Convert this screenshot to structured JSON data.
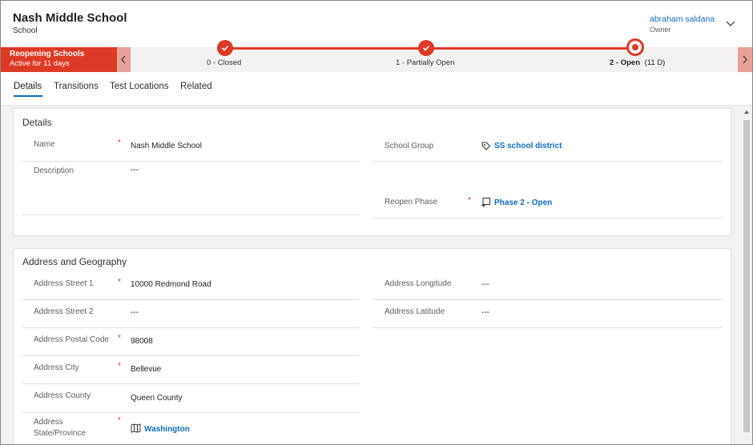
{
  "record": {
    "title": "Nash Middle School",
    "entity": "School"
  },
  "owner": {
    "name": "abraham saldana",
    "label": "Owner",
    "chevron_icon": "chevron-down-icon"
  },
  "bpf": {
    "process_name": "Reopening Schools",
    "active_for": "Active for 11 days",
    "stages": [
      {
        "label": "0 - Closed",
        "status": "completed"
      },
      {
        "label": "1 - Partially Open",
        "status": "completed"
      },
      {
        "label": "2 - Open",
        "duration": "(11 D)",
        "status": "active"
      }
    ],
    "accent_color": "#dd3a26"
  },
  "tabs": [
    {
      "label": "Details",
      "selected": true
    },
    {
      "label": "Transitions",
      "selected": false
    },
    {
      "label": "Test Locations",
      "selected": false
    },
    {
      "label": "Related",
      "selected": false
    }
  ],
  "details": {
    "title": "Details",
    "name_label": "Name",
    "name_value": "Nash Middle School",
    "description_label": "Description",
    "description_value": "---",
    "school_group_label": "School Group",
    "school_group_value": "SS school district",
    "reopen_phase_label": "Reopen Phase",
    "reopen_phase_value": "Phase 2 - Open",
    "required_marker": "*"
  },
  "address": {
    "title": "Address and Geography",
    "street1_label": "Address Street 1",
    "street1_value": "10000 Redmond Road",
    "street2_label": "Address Street 2",
    "street2_value": "---",
    "postal_label": "Address Postal Code",
    "postal_value": "98008",
    "city_label": "Address City",
    "city_value": "Bellevue",
    "county_label": "Address County",
    "county_value": "Queen County",
    "state_label_1": "Address",
    "state_label_2": "State/Province",
    "state_value": "Washington",
    "longitude_label": "Address Longitude",
    "longitude_value": "---",
    "latitude_label": "Address Latitude",
    "latitude_value": "---",
    "required_marker": "*"
  },
  "colors": {
    "link": "#0f6cbd",
    "required": "#d13438"
  }
}
